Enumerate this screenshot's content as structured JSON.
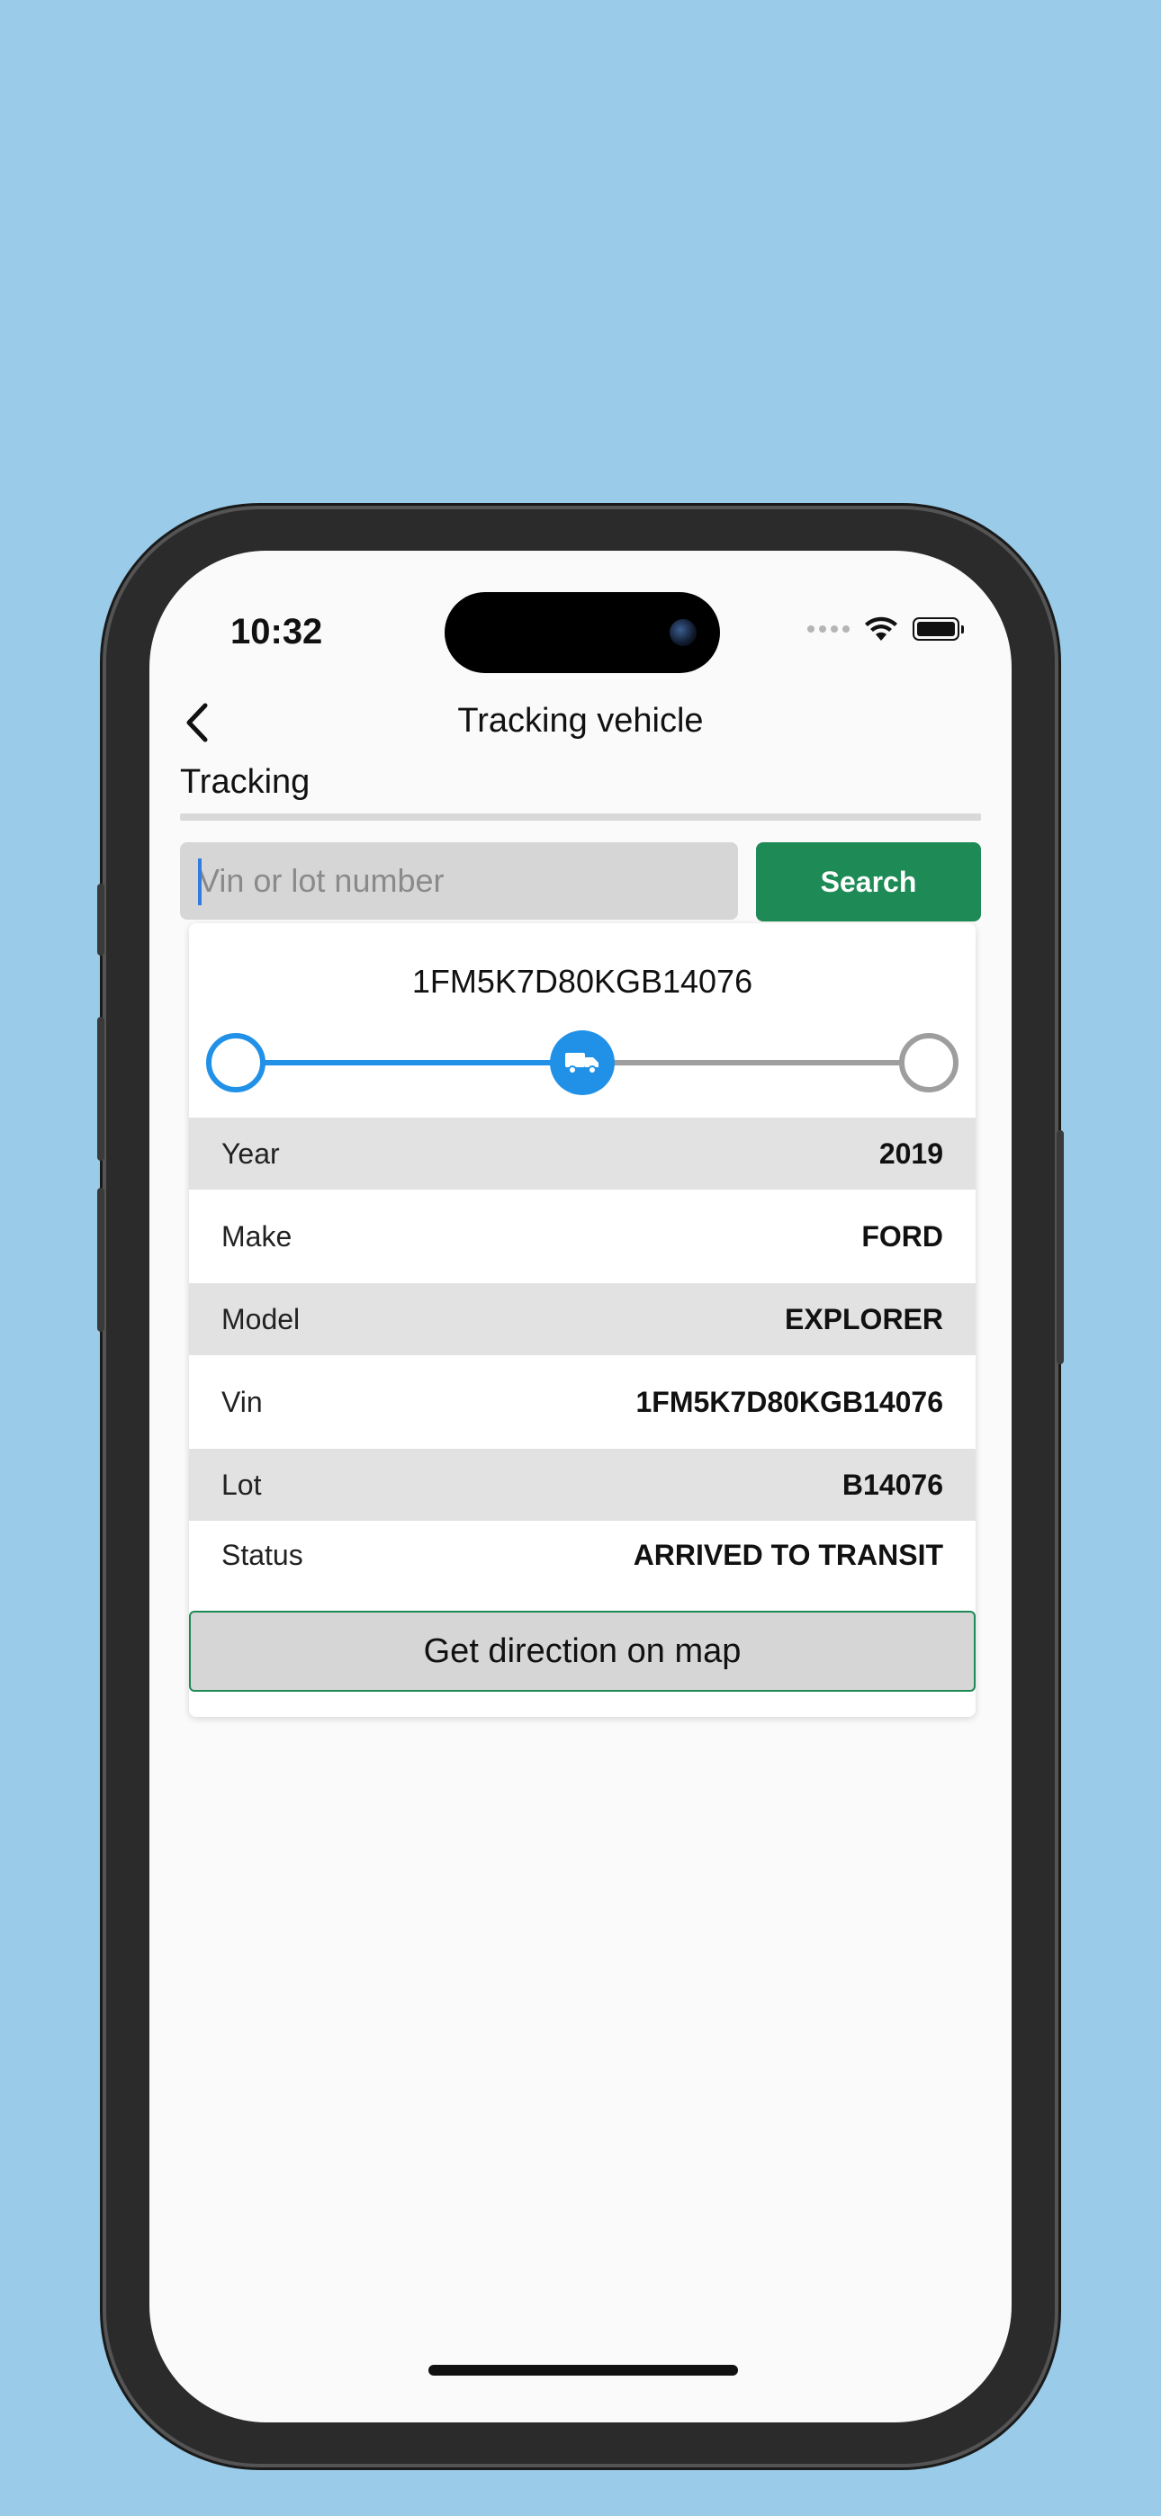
{
  "status_bar": {
    "time": "10:32"
  },
  "header": {
    "title": "Tracking vehicle"
  },
  "section": {
    "label": "Tracking"
  },
  "search": {
    "placeholder": "Vin or lot number",
    "button_label": "Search"
  },
  "vehicle_card": {
    "vin_title": "1FM5K7D80KGB14076",
    "progress_step": 2,
    "progress_total_steps": 3,
    "details": [
      {
        "label": "Year",
        "value": "2019"
      },
      {
        "label": "Make",
        "value": "FORD"
      },
      {
        "label": "Model",
        "value": "EXPLORER"
      },
      {
        "label": "Vin",
        "value": "1FM5K7D80KGB14076"
      },
      {
        "label": "Lot",
        "value": "B14076"
      },
      {
        "label": "Status",
        "value": "ARRIVED TO TRANSIT"
      }
    ],
    "map_button_label": "Get direction on map"
  },
  "colors": {
    "background": "#9acbe8",
    "accent_blue": "#2191e8",
    "brand_green": "#1e8a55",
    "inactive_gray": "#9e9e9e"
  },
  "icons": {
    "back": "chevron-left-icon",
    "current_step": "truck-icon"
  }
}
